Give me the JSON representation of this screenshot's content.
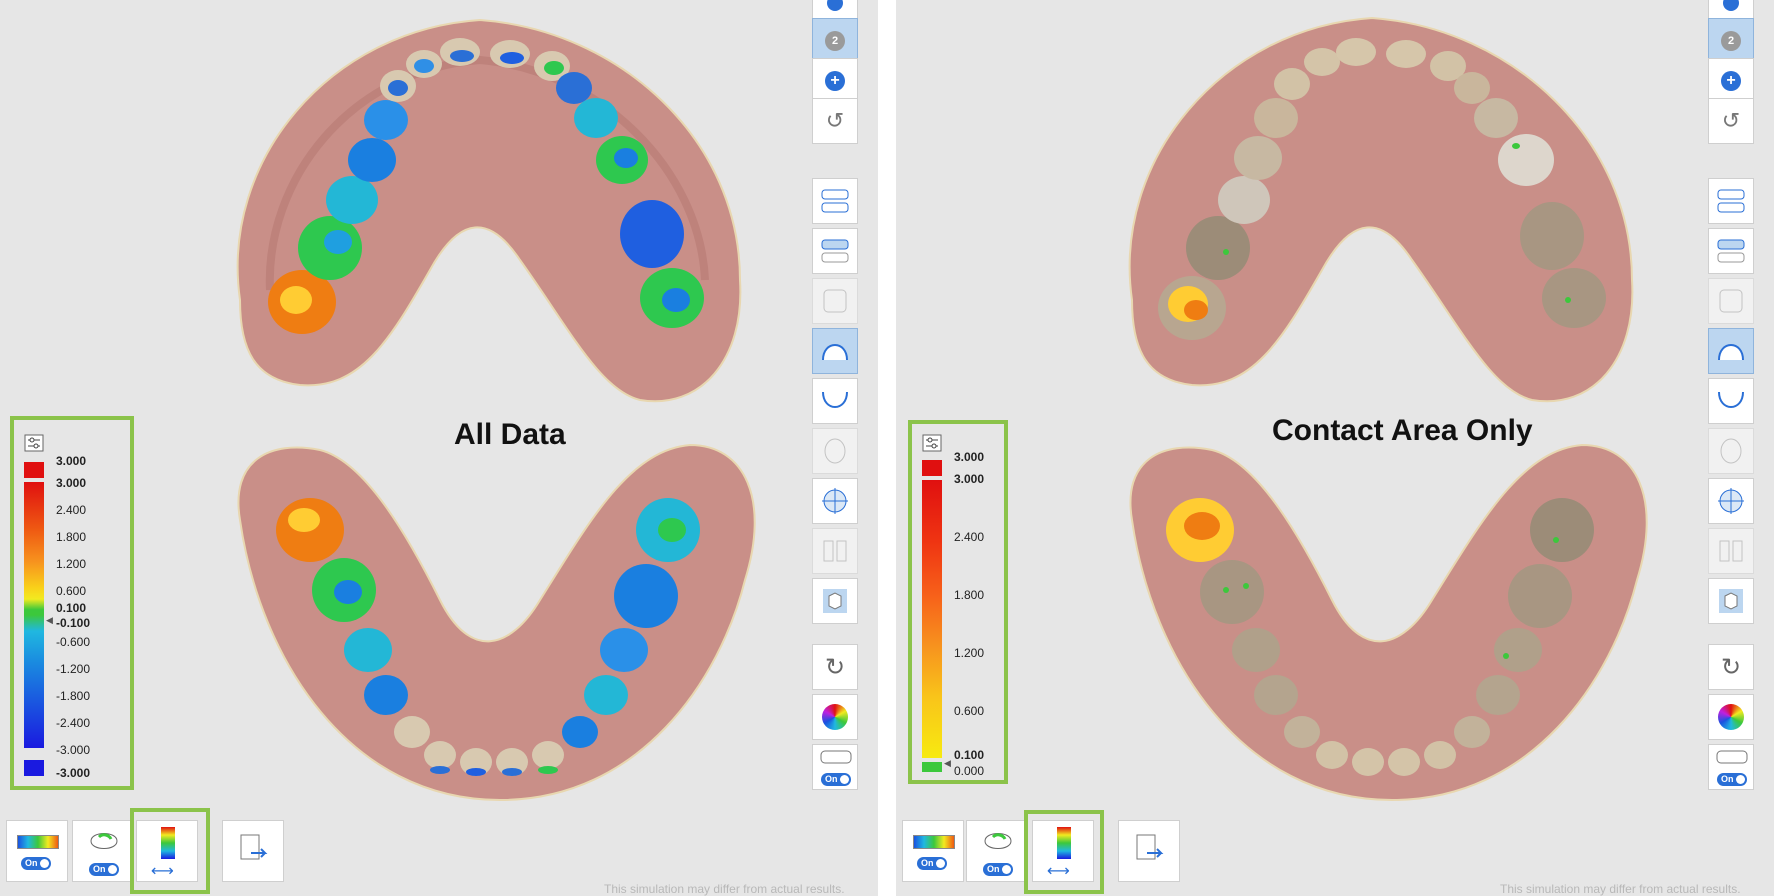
{
  "left_panel": {
    "caption": "All Data",
    "legend": {
      "labels": [
        "3.000",
        "3.000",
        "2.400",
        "1.800",
        "1.200",
        "0.600",
        "0.100",
        "-0.100",
        "-0.600",
        "-1.200",
        "-1.800",
        "-2.400",
        "-3.000",
        "-3.000"
      ]
    },
    "disclaimer": "This simulation may differ from actual results.",
    "toggle_on_1": "On",
    "toggle_on_2": "On"
  },
  "right_panel": {
    "caption": "Contact Area Only",
    "legend": {
      "labels": [
        "3.000",
        "3.000",
        "2.400",
        "1.800",
        "1.200",
        "0.600",
        "0.100",
        "0.000"
      ]
    },
    "disclaimer": "This simulation may differ from actual results.",
    "toggle_on_1": "On",
    "toggle_on_2": "On"
  },
  "toolbar": {
    "step_badge": "2",
    "toggle_label": "On"
  },
  "colors": {
    "highlight": "#8bc34a",
    "background": "#e6e6e6",
    "gum": "#c98f88",
    "tooth": "#d8c9b0",
    "accent": "#2a6fd6"
  }
}
